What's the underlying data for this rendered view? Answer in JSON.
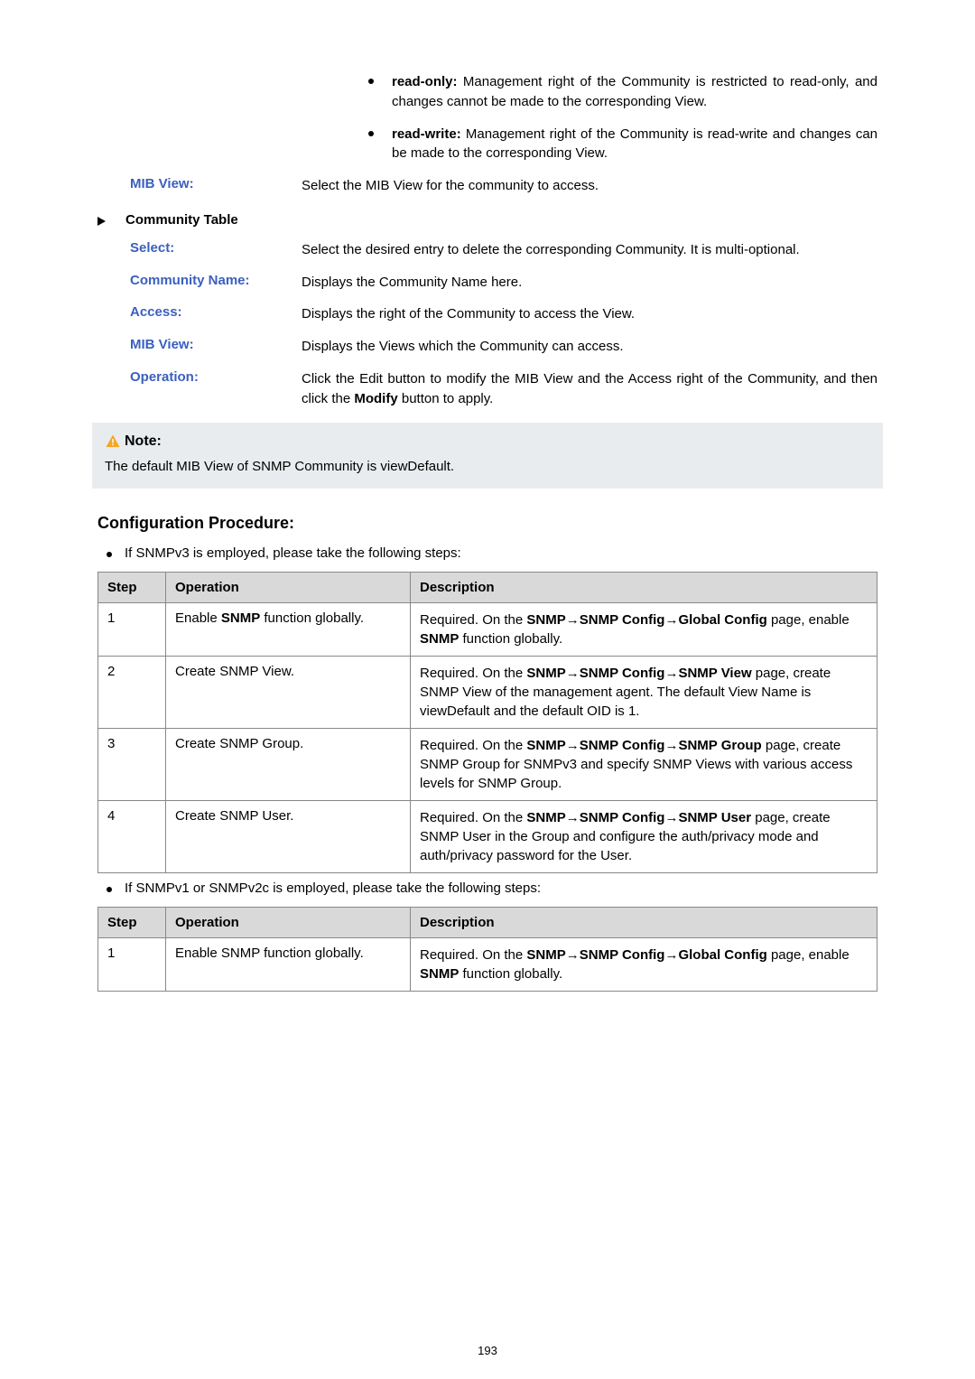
{
  "top_bullets": [
    {
      "strong": "read-only:",
      "rest": " Management right of the Community is restricted to read-only, and changes cannot be made to the corresponding View."
    },
    {
      "strong": "read-write:",
      "rest": " Management right of the Community is read-write and changes can be made to the corresponding View."
    }
  ],
  "defs_above": [
    {
      "label": "MIB View:",
      "text": "Select the MIB View for the community to access."
    }
  ],
  "community_table_heading": "Community Table",
  "defs_below": [
    {
      "label": "Select:",
      "text": "Select the desired entry to delete the corresponding Community. It is multi-optional."
    },
    {
      "label": "Community Name:",
      "text": "Displays the Community Name here."
    },
    {
      "label": "Access:",
      "text": "Displays the right of the Community to access the View."
    },
    {
      "label": "MIB View:",
      "text": "Displays the Views which the Community can access."
    },
    {
      "label": "Operation:",
      "text_html": "Click the Edit button to modify the MIB View and the Access right of the Community, and then click the <b>Modify</b> button to apply."
    }
  ],
  "note": {
    "title": "Note:",
    "text": "The default MIB View of SNMP Community is viewDefault."
  },
  "config_title": "Configuration Procedure:",
  "lead1": "If SNMPv3 is employed, please take the following steps:",
  "table_headers": {
    "step": "Step",
    "operation": "Operation",
    "description": "Description"
  },
  "table1": [
    {
      "step": "1",
      "op_html": "Enable <b>SNMP</b> function globally.",
      "desc_html": "Required. On the <b>SNMP→SNMP Config→Global Config</b> page, enable <b>SNMP</b> function globally."
    },
    {
      "step": "2",
      "op_html": "Create SNMP View.",
      "desc_html": "Required. On the <b>SNMP→SNMP Config→SNMP View</b> page, create SNMP View of the management agent. The default View Name is viewDefault and the default OID is 1."
    },
    {
      "step": "3",
      "op_html": "Create SNMP Group.",
      "desc_html": "Required. On the <b>SNMP→SNMP Config→SNMP Group</b> page, create SNMP Group for SNMPv3 and specify SNMP Views with various access levels for SNMP Group."
    },
    {
      "step": "4",
      "op_html": "Create SNMP User.",
      "desc_html": "Required. On the <b>SNMP→SNMP Config→SNMP User</b> page, create SNMP User in the Group and configure the auth/privacy mode and auth/privacy password for the User."
    }
  ],
  "lead2": "If SNMPv1 or SNMPv2c is employed, please take the following steps:",
  "table2": [
    {
      "step": "1",
      "op_html": "Enable SNMP function globally.",
      "desc_html": "Required. On the <b>SNMP→SNMP Config→Global Config</b> page, enable <b>SNMP</b> function globally."
    }
  ],
  "page_number": "193"
}
